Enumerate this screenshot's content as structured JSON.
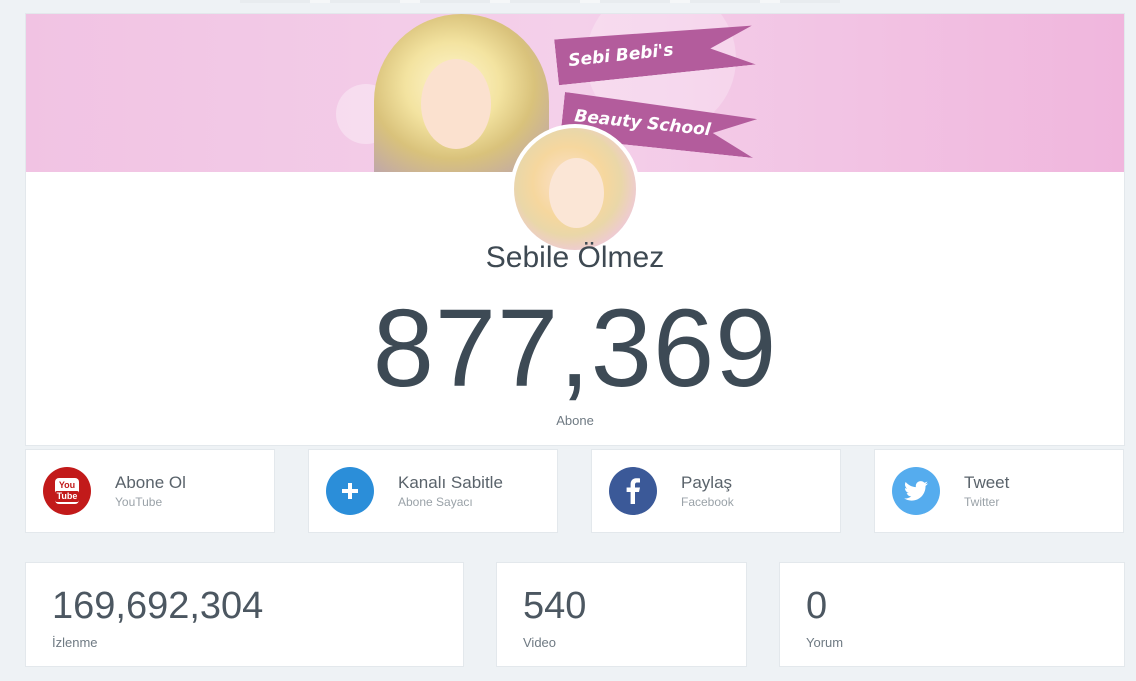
{
  "channel": {
    "name": "Sebile Ölmez",
    "subscriber_count": "877,369",
    "subscriber_label": "Abone",
    "banner": {
      "pennant_top": "Sebi Bebi's",
      "pennant_bottom": "Beauty School"
    }
  },
  "actions": [
    {
      "title": "Abone Ol",
      "subtitle": "YouTube",
      "icon": "youtube-icon",
      "color": "#c21a1a",
      "badge_top": "You",
      "badge_bottom": "Tube"
    },
    {
      "title": "Kanalı Sabitle",
      "subtitle": "Abone Sayacı",
      "icon": "plus-icon",
      "color": "#2b8ed9"
    },
    {
      "title": "Paylaş",
      "subtitle": "Facebook",
      "icon": "facebook-icon",
      "color": "#3b5998"
    },
    {
      "title": "Tweet",
      "subtitle": "Twitter",
      "icon": "twitter-icon",
      "color": "#55acee"
    }
  ],
  "stats": [
    {
      "value": "169,692,304",
      "label": "İzlenme"
    },
    {
      "value": "540",
      "label": "Video"
    },
    {
      "value": "0",
      "label": "Yorum"
    }
  ]
}
